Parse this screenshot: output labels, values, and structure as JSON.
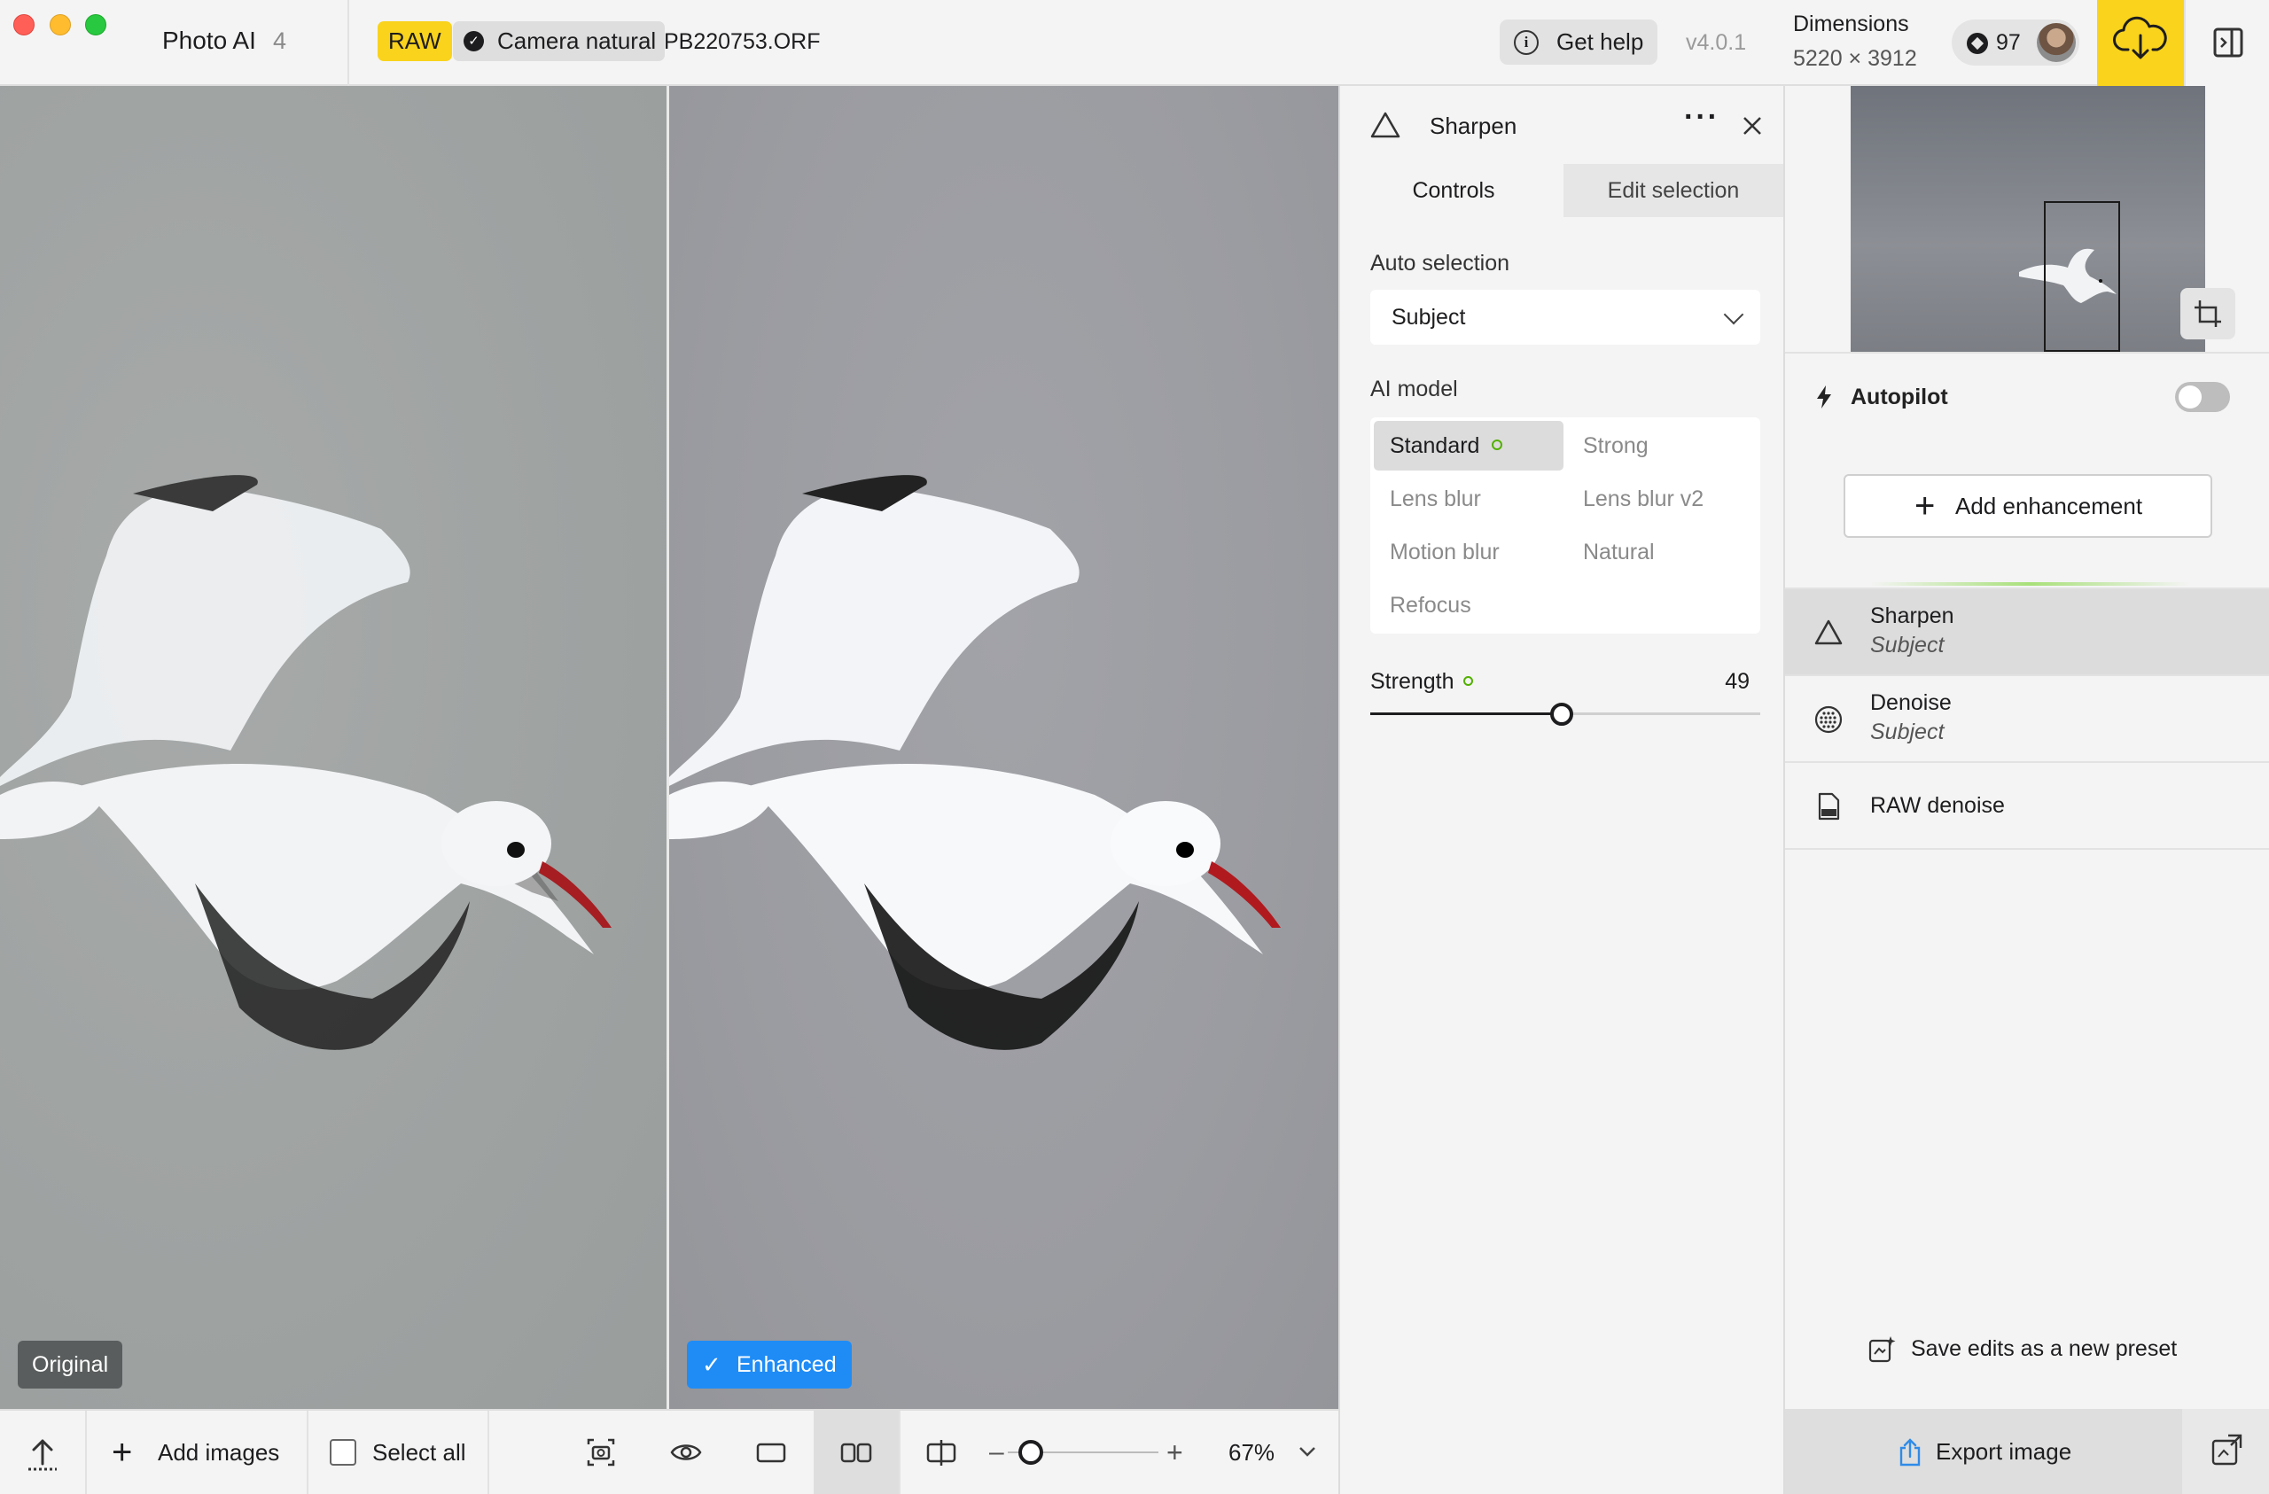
{
  "titlebar": {
    "app_name": "Photo AI",
    "app_version_major": "4",
    "raw_badge": "RAW",
    "camera_profile": "Camera natural",
    "filename": "PB220753.ORF",
    "help_label": "Get help",
    "version": "v4.0.1",
    "dimensions_label": "Dimensions",
    "dimensions_value": "5220 × 3912",
    "credits": "97"
  },
  "viewer": {
    "original_label": "Original",
    "enhanced_label": "Enhanced"
  },
  "bottombar": {
    "add_images": "Add images",
    "select_all": "Select all",
    "zoom": "67%",
    "zoom_fraction": 0.2
  },
  "panel": {
    "title": "Sharpen",
    "tab_controls": "Controls",
    "tab_edit": "Edit selection",
    "auto_selection_label": "Auto selection",
    "auto_selection_value": "Subject",
    "ai_model_label": "AI model",
    "models": [
      "Standard",
      "Strong",
      "Lens blur",
      "Lens blur v2",
      "Motion blur",
      "Natural",
      "Refocus"
    ],
    "selected_model": "Standard",
    "strength_label": "Strength",
    "strength_value": "49",
    "strength_fraction": 0.49
  },
  "sidebar": {
    "autopilot_label": "Autopilot",
    "autopilot_on": false,
    "add_enhancement": "Add enhancement",
    "enhancements": [
      {
        "name": "Sharpen",
        "sub": "Subject",
        "icon": "triangle-icon"
      },
      {
        "name": "Denoise",
        "sub": "Subject",
        "icon": "dots-circle-icon"
      },
      {
        "name": "RAW denoise",
        "sub": "",
        "icon": "raw-file-icon"
      }
    ],
    "save_preset": "Save edits as a new preset",
    "export_label": "Export image"
  },
  "colors": {
    "accent_yellow": "#f9d31c",
    "accent_blue": "#1f8cf6",
    "active_green": "#52b000"
  }
}
